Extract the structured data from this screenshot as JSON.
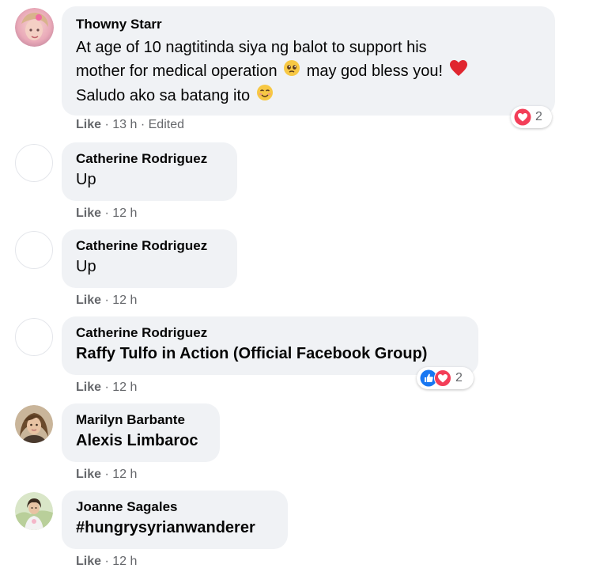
{
  "comments": [
    {
      "author": "Thowny Starr",
      "lines": [
        "At age of 10 nagtitinda siya ng balot to support his",
        "mother for medical operation",
        "may god bless you!",
        "Saludo ako sa batang ito"
      ],
      "like_label": "Like",
      "time": "13 h",
      "edited": "Edited",
      "reaction_count": "2",
      "reactions": [
        "heart-reaction-icon"
      ]
    },
    {
      "author": "Catherine Rodriguez",
      "text": "Up",
      "like_label": "Like",
      "time": "12 h"
    },
    {
      "author": "Catherine Rodriguez",
      "text": "Up",
      "like_label": "Like",
      "time": "12 h"
    },
    {
      "author": "Catherine Rodriguez",
      "text": "Raffy Tulfo in Action (Official Facebook Group)",
      "like_label": "Like",
      "time": "12 h",
      "reaction_count": "2",
      "reactions": [
        "like-reaction-icon",
        "heart-reaction-icon"
      ]
    },
    {
      "author": "Marilyn Barbante",
      "text": "Alexis Limbaroc",
      "like_label": "Like",
      "time": "12 h"
    },
    {
      "author": "Joanne Sagales",
      "text": "#hungrysyrianwanderer",
      "like_label": "Like",
      "time": "12 h"
    }
  ],
  "separator": "·",
  "colors": {
    "bubble": "#f0f2f5",
    "meta": "#65676b",
    "like_blue": "#1877f2",
    "love_red": "#f33e58"
  }
}
